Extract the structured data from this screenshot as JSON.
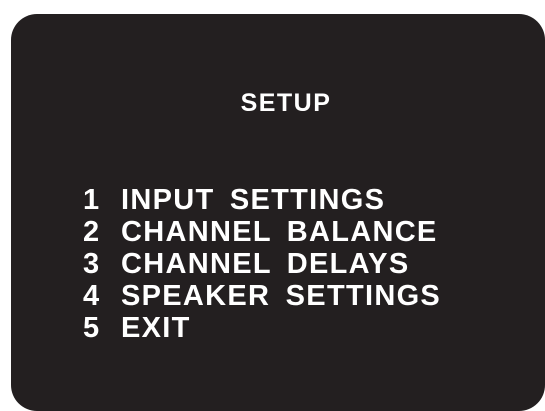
{
  "title": "SETUP",
  "menu": {
    "items": [
      {
        "number": "1",
        "label": "INPUT SETTINGS"
      },
      {
        "number": "2",
        "label": "CHANNEL BALANCE"
      },
      {
        "number": "3",
        "label": "CHANNEL DELAYS"
      },
      {
        "number": "4",
        "label": "SPEAKER SETTINGS"
      },
      {
        "number": "5",
        "label": "EXIT"
      }
    ]
  },
  "colors": {
    "screen_background": "#231f20",
    "text": "#ffffff"
  }
}
